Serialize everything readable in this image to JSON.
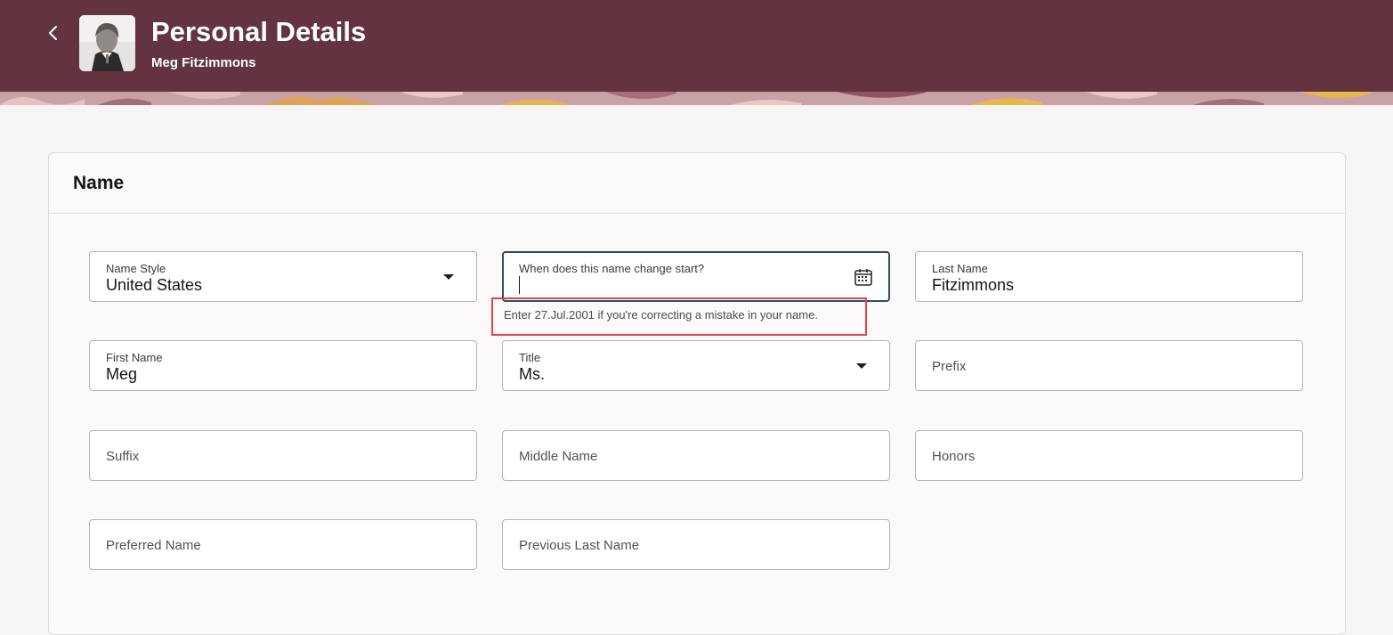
{
  "header": {
    "title": "Personal Details",
    "subtitle": "Meg Fitzimmons",
    "back_icon": "chevron-left-icon",
    "avatar": "user-photo",
    "background_color": "#633440"
  },
  "section": {
    "title": "Name"
  },
  "fields": {
    "name_style": {
      "label": "Name Style",
      "value": "United States"
    },
    "start_date": {
      "label": "When does this name change start?",
      "value": "",
      "hint": "Enter 27.Jul.2001 if you're correcting a mistake in your name."
    },
    "last_name": {
      "label": "Last Name",
      "value": "Fitzimmons"
    },
    "first_name": {
      "label": "First Name",
      "value": "Meg"
    },
    "title": {
      "label": "Title",
      "value": "Ms."
    },
    "prefix": {
      "label": "Prefix"
    },
    "suffix": {
      "label": "Suffix"
    },
    "middle_name": {
      "label": "Middle Name"
    },
    "honors": {
      "label": "Honors"
    },
    "preferred_name": {
      "label": "Preferred Name"
    },
    "previous_last_name": {
      "label": "Previous Last Name"
    }
  },
  "highlight_color": "#e3444b"
}
